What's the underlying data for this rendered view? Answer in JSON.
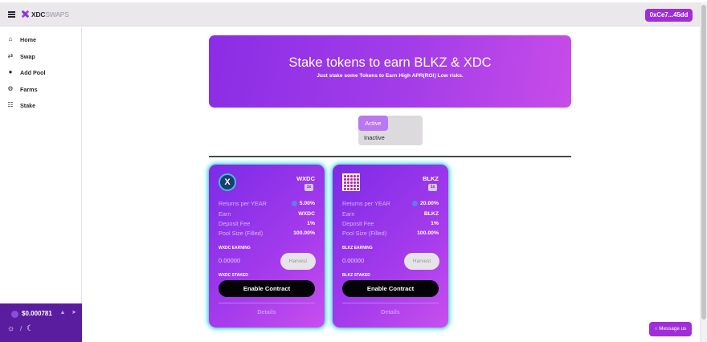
{
  "header": {
    "logo_bold": "XDC",
    "logo_thin": "SWAPS",
    "wallet_label": "0xCe7...45dd"
  },
  "sidebar": {
    "items": [
      {
        "label": "Home",
        "icon": "home-icon"
      },
      {
        "label": "Swap",
        "icon": "swap-icon"
      },
      {
        "label": "Add Pool",
        "icon": "add-pool-icon"
      },
      {
        "label": "Farms",
        "icon": "farms-icon"
      },
      {
        "label": "Stake",
        "icon": "stake-icon"
      }
    ],
    "price": "$0.000781"
  },
  "banner": {
    "title": "Stake tokens to earn BLKZ & XDC",
    "subtitle": "Just stake some Tokens to Earn High APR(ROI) Low risks."
  },
  "tabs": {
    "active": "Active",
    "inactive": "Inactive"
  },
  "pools": [
    {
      "token": "WXDC",
      "multiplier": "1x",
      "returns_label": "Returns per YEAR",
      "returns_value": "5.00%",
      "earn_label": "Earn",
      "earn_value": "WXDC",
      "fee_label": "Deposit Fee",
      "fee_value": "1%",
      "pool_label": "Pool Size (Filled)",
      "pool_value": "100.00%",
      "earning_label": "WXDC EARNING",
      "earning_value": "0.00000",
      "harvest_label": "Harvest",
      "staked_label": "WXDC STAKED",
      "enable_label": "Enable Contract",
      "details_label": "Details"
    },
    {
      "token": "BLKZ",
      "multiplier": "1x",
      "returns_label": "Returns per YEAR",
      "returns_value": "20.00%",
      "earn_label": "Earn",
      "earn_value": "BLKZ",
      "fee_label": "Deposit Fee",
      "fee_value": "1%",
      "pool_label": "Pool Size (Filled)",
      "pool_value": "100.00%",
      "earning_label": "BLKZ EARNING",
      "earning_value": "0.00000",
      "harvest_label": "Harvest",
      "staked_label": "BLKZ STAKED",
      "enable_label": "Enable Contract",
      "details_label": "Details"
    }
  ],
  "message_button": "Message us",
  "colors": {
    "accent": "#a12dd9",
    "sidebar_footer": "#5a1d9f",
    "card_glow": "#44e6ec"
  }
}
